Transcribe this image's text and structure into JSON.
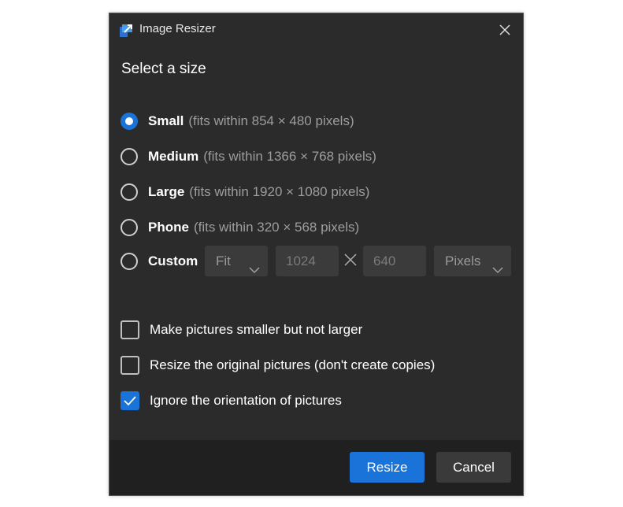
{
  "window": {
    "title": "Image Resizer",
    "app_icon": "image-resizer-icon",
    "close_icon": "close-icon"
  },
  "heading": "Select a size",
  "sizes": [
    {
      "label": "Small",
      "desc": "(fits within 854 × 480 pixels)",
      "selected": true
    },
    {
      "label": "Medium",
      "desc": "(fits within 1366 × 768 pixels)",
      "selected": false
    },
    {
      "label": "Large",
      "desc": "(fits within 1920 × 1080 pixels)",
      "selected": false
    },
    {
      "label": "Phone",
      "desc": "(fits within 320 × 568 pixels)",
      "selected": false
    },
    {
      "label": "Custom",
      "desc": "",
      "selected": false
    }
  ],
  "custom": {
    "fit_value": "Fit",
    "width_placeholder": "1024",
    "height_placeholder": "640",
    "separator_icon": "times-icon",
    "unit_value": "Pixels"
  },
  "options": [
    {
      "label": "Make pictures smaller but not larger",
      "checked": false
    },
    {
      "label": "Resize the original pictures (don't create copies)",
      "checked": false
    },
    {
      "label": "Ignore the orientation of pictures",
      "checked": true
    }
  ],
  "buttons": {
    "resize": "Resize",
    "cancel": "Cancel"
  },
  "colors": {
    "accent": "#1a73d9",
    "background": "#2b2b2b",
    "footer": "#202020",
    "secondary_text": "#9d9d9d"
  }
}
